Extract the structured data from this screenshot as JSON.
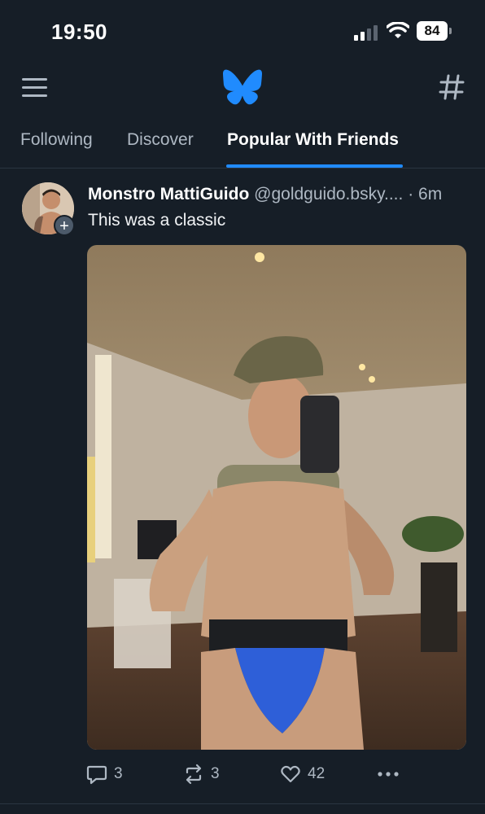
{
  "status_bar": {
    "time": "19:50",
    "battery": "84"
  },
  "tabs": [
    {
      "label": "Following"
    },
    {
      "label": "Discover"
    },
    {
      "label": "Popular With Friends"
    }
  ],
  "post": {
    "author_name": "Monstro MattiGuido",
    "handle": "@goldguido.bsky....",
    "separator": "·",
    "age": "6m",
    "text": "This was a classic",
    "actions": {
      "replies": "3",
      "reposts": "3",
      "likes": "42"
    }
  },
  "colors": {
    "background": "#161e27",
    "accent": "#208bfe",
    "muted": "#aeb8c3"
  }
}
